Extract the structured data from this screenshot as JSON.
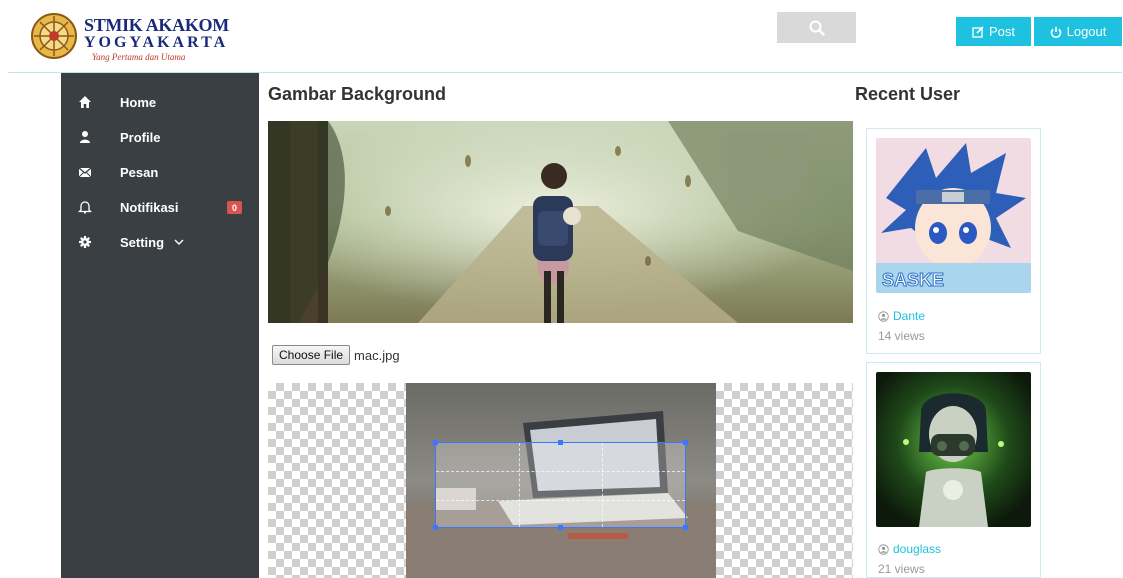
{
  "brand": {
    "line1": "STMIK AKAKOM",
    "line2": "YOGYAKARTA",
    "tagline": "Yang Pertama dan Utama"
  },
  "header": {
    "search_icon": "search-icon",
    "post_label": "Post",
    "logout_label": "Logout",
    "accent_color": "#1ec2e0"
  },
  "sidebar": {
    "items": [
      {
        "label": "Home",
        "icon": "home-icon"
      },
      {
        "label": "Profile",
        "icon": "user-icon"
      },
      {
        "label": "Pesan",
        "icon": "envelope-icon"
      },
      {
        "label": "Notifikasi",
        "icon": "bell-icon",
        "badge": "0"
      },
      {
        "label": "Setting",
        "icon": "gear-icon"
      }
    ]
  },
  "main": {
    "title": "Gambar Background",
    "file_button": "Choose File",
    "file_name": "mac.jpg"
  },
  "recent": {
    "title": "Recent User",
    "users": [
      {
        "name": "Dante",
        "views": "14 views"
      },
      {
        "name": "douglass",
        "views": "21 views"
      }
    ]
  }
}
